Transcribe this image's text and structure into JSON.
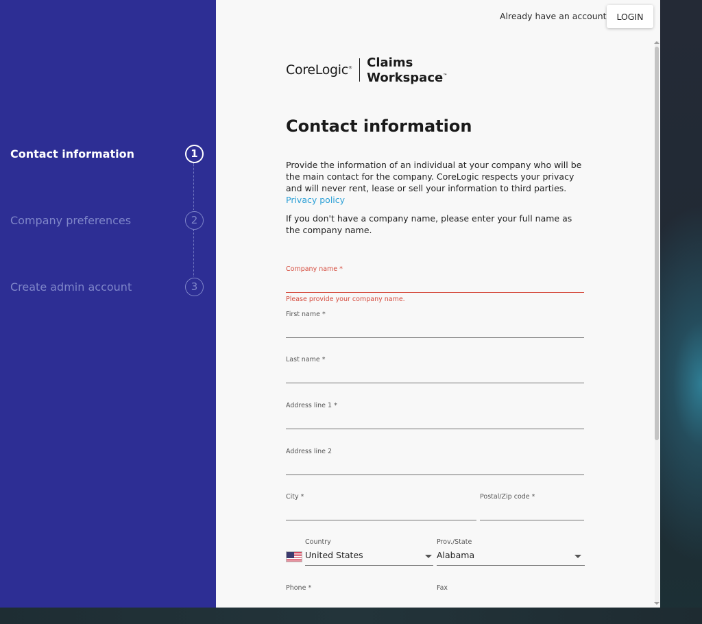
{
  "sidebar": {
    "steps": [
      {
        "label": "Contact information",
        "number": "1",
        "active": true
      },
      {
        "label": "Company preferences",
        "number": "2",
        "active": false
      },
      {
        "label": "Create admin account",
        "number": "3",
        "active": false
      }
    ]
  },
  "topbar": {
    "account_prompt": "Already have an account?",
    "login_label": "LOGIN"
  },
  "logo": {
    "brand": "CoreLogic",
    "brand_mark": "®",
    "product_line1": "Claims",
    "product_line2": "Workspace",
    "product_mark": "™"
  },
  "form": {
    "title": "Contact information",
    "intro": "Provide the information of an individual at your company who will be the main contact for the company. CoreLogic respects your privacy and will never rent, lease or sell your information to third parties.",
    "privacy_link": "Privacy policy",
    "company_note": "If you don't have a company name, please enter your full name as the company name.",
    "fields": {
      "company_name": {
        "label": "Company name *",
        "value": "",
        "error": "Please provide your company name."
      },
      "first_name": {
        "label": "First name *",
        "value": ""
      },
      "last_name": {
        "label": "Last name *",
        "value": ""
      },
      "address1": {
        "label": "Address line 1 *",
        "value": ""
      },
      "address2": {
        "label": "Address line 2",
        "value": ""
      },
      "city": {
        "label": "City *",
        "value": ""
      },
      "postal": {
        "label": "Postal/Zip code *",
        "value": ""
      },
      "country": {
        "label": "Country",
        "value": "United States",
        "flag_icon": "us-flag-icon"
      },
      "state": {
        "label": "Prov./State",
        "value": "Alabama"
      },
      "phone": {
        "label": "Phone *",
        "value": ""
      },
      "fax": {
        "label": "Fax",
        "value": ""
      }
    }
  },
  "colors": {
    "sidebar_bg": "#2d2e94",
    "error": "#d54a3c",
    "link": "#2a9fd6"
  }
}
